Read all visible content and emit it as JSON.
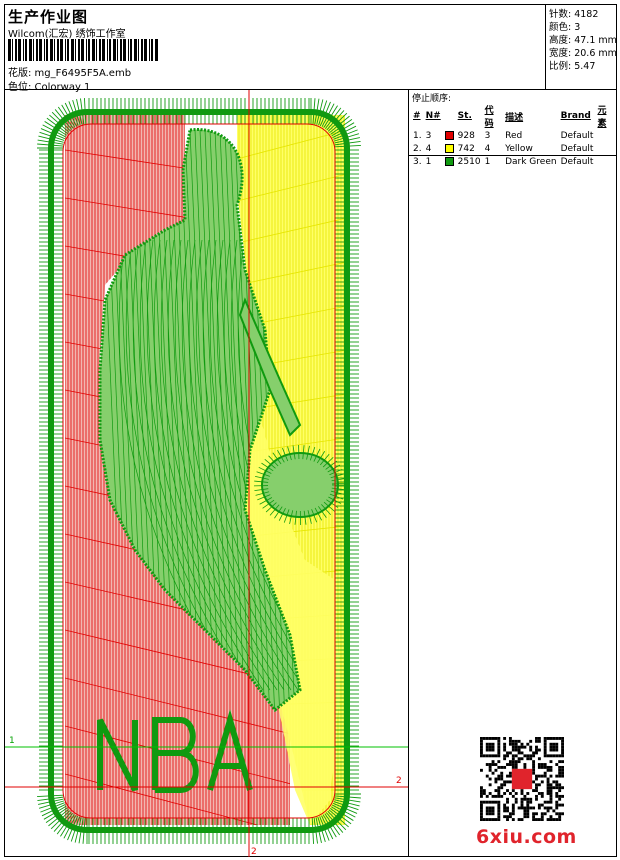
{
  "header": {
    "title": "生产作业图",
    "company": "Wilcom(汇宏) 绣饰工作室",
    "design": "花版:   mg_F6495F5A.emb",
    "colorway": "色位:   Colorway 1"
  },
  "stats": {
    "stitches": "针数: 4182",
    "colors": "颜色: 3",
    "height": "高度: 47.1 mm",
    "width": "宽度: 20.6 mm",
    "ratio": "比例: 5.47"
  },
  "stops": {
    "caption": "停止顺序:",
    "headers": [
      "#",
      "N#",
      "",
      "St.",
      "代码",
      "描述",
      "Brand",
      "元素"
    ],
    "rows": [
      {
        "num": "1.",
        "n": "3",
        "swatch": "#e00000",
        "st": "928",
        "code": "3",
        "desc": "Red",
        "brand": "Default"
      },
      {
        "num": "2.",
        "n": "4",
        "swatch": "#ffff00",
        "st": "742",
        "code": "4",
        "desc": "Yellow",
        "brand": "Default"
      },
      {
        "num": "3.",
        "n": "1",
        "swatch": "#109a10",
        "st": "2510",
        "code": "1",
        "desc": "Dark Green",
        "brand": "Default"
      }
    ]
  },
  "canvas": {
    "guide_labels": [
      "1",
      "2",
      "2"
    ],
    "lettering": "NBA"
  },
  "watermark": {
    "site": "6xiu.com"
  },
  "colors": {
    "red": "#e00000",
    "yellow": "#ffff00",
    "green": "#109a10",
    "guide": "#00c000"
  }
}
